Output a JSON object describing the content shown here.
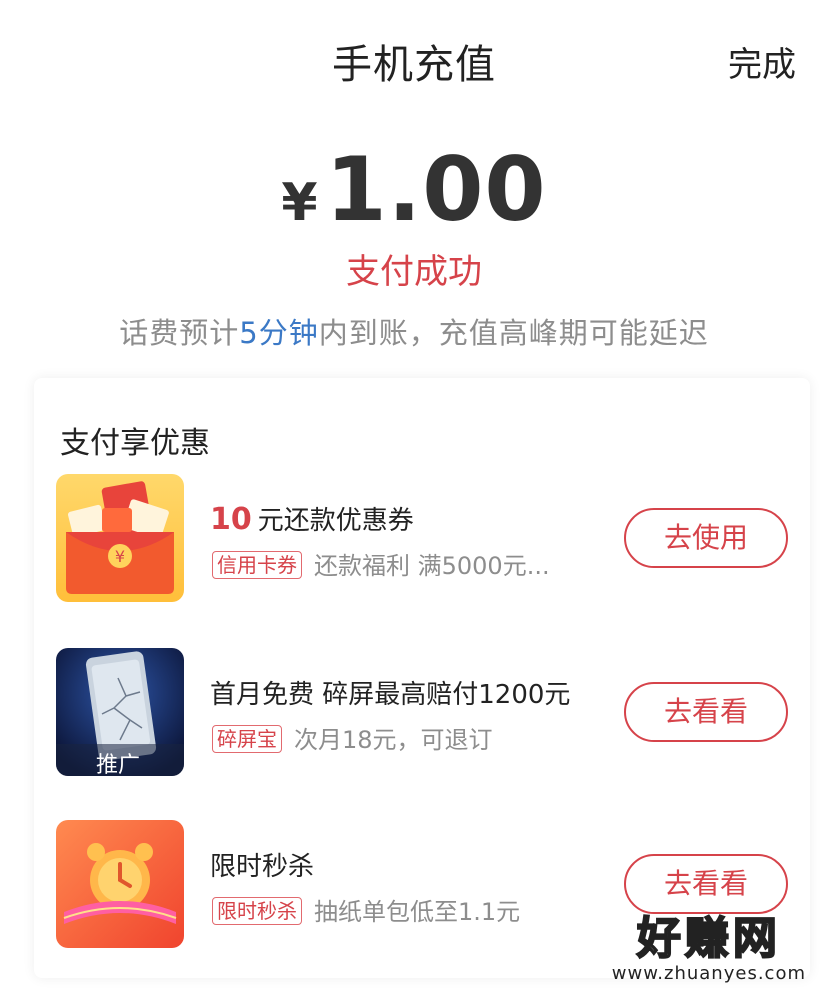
{
  "header": {
    "title": "手机充值",
    "done_label": "完成"
  },
  "payment": {
    "currency_symbol": "¥",
    "amount": "1.00",
    "status": "支付成功",
    "note_prefix": "话费预计",
    "note_highlight": "5分钟",
    "note_suffix": "内到账，充值高峰期可能延迟"
  },
  "offers": {
    "section_title": "支付享优惠",
    "items": [
      {
        "title_number": "10",
        "title": "元还款优惠券",
        "tag": "信用卡券",
        "subtitle": "还款福利 满5000元...",
        "action": "去使用"
      },
      {
        "title": "首月免费  碎屏最高赔付1200元",
        "tag": "碎屏宝",
        "subtitle": "次月18元，可退订",
        "action": "去看看",
        "thumb_caption": "推广"
      },
      {
        "title": "限时秒杀",
        "tag": "限时秒杀",
        "subtitle": "抽纸单包低至1.1元",
        "action": "去看看"
      }
    ]
  },
  "watermark": {
    "brand": "好赚网",
    "domain": "www.zhuanyes.com"
  },
  "colors": {
    "accent_red": "#d6434a",
    "highlight_blue": "#3b79c6",
    "muted_text": "#8d8d8d"
  },
  "icons": {
    "coupon_thumb": "red-envelope-coupon-icon",
    "screen_thumb": "cracked-phone-icon",
    "flash_sale_thumb": "alarm-clock-icon"
  }
}
